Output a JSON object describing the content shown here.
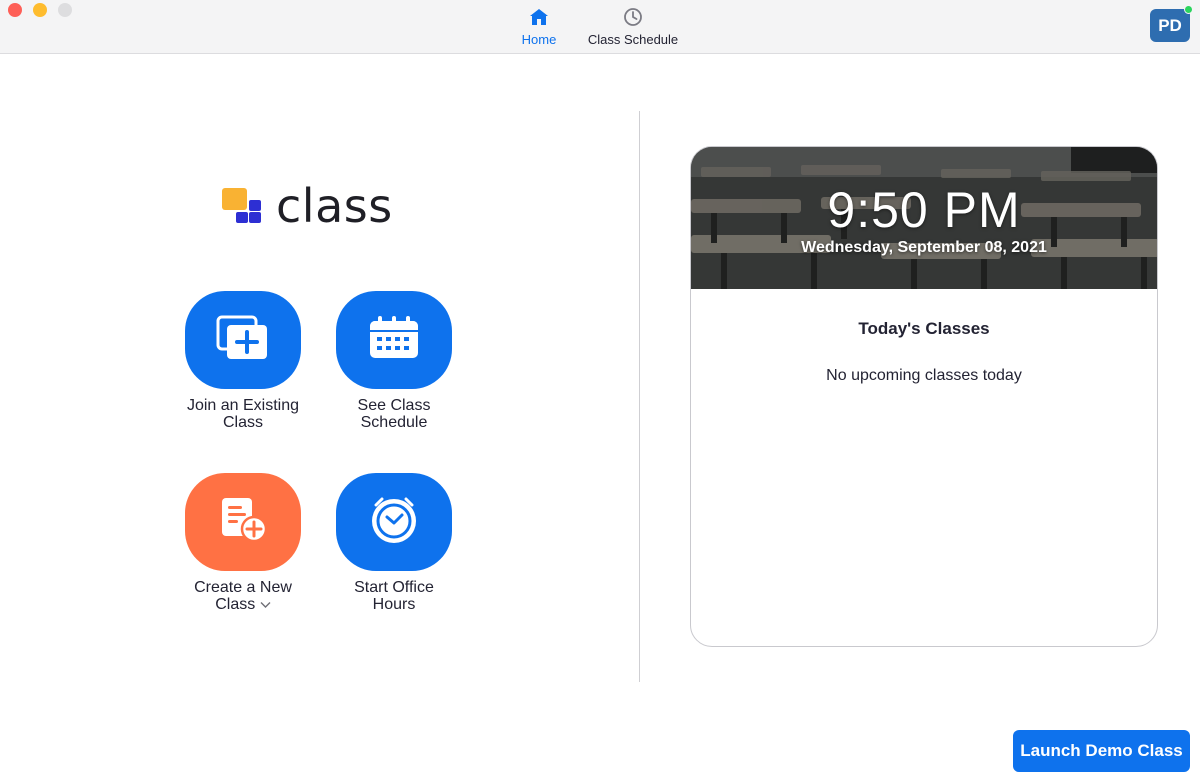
{
  "window": {
    "controls": [
      "close",
      "minimize",
      "zoom"
    ]
  },
  "nav": {
    "tabs": [
      {
        "label": "Home",
        "icon": "home-icon",
        "active": true
      },
      {
        "label": "Class Schedule",
        "icon": "clock-icon",
        "active": false
      }
    ]
  },
  "user": {
    "initials": "PD",
    "status_color": "#2bd45e"
  },
  "logo": {
    "text": "class"
  },
  "actions": [
    {
      "label_line1": "Join an Existing",
      "label_line2": "Class",
      "icon": "join-class-icon",
      "color": "#0e72ed"
    },
    {
      "label_line1": "See Class",
      "label_line2": "Schedule",
      "icon": "calendar-icon",
      "color": "#0e72ed"
    },
    {
      "label_line1": "Create a New",
      "label_line2": "Class",
      "icon": "create-class-icon",
      "color": "#ff7144",
      "has_dropdown": true
    },
    {
      "label_line1": "Start Office",
      "label_line2": "Hours",
      "icon": "stopwatch-icon",
      "color": "#0e72ed"
    }
  ],
  "card": {
    "time": "9:50 PM",
    "date": "Wednesday, September 08, 2021",
    "title": "Today's Classes",
    "empty_message": "No upcoming classes today"
  },
  "footer": {
    "launch_label": "Launch Demo Class"
  },
  "colors": {
    "accent": "#0e72ed",
    "orange": "#ff7144",
    "avatar": "#2e6db0"
  }
}
